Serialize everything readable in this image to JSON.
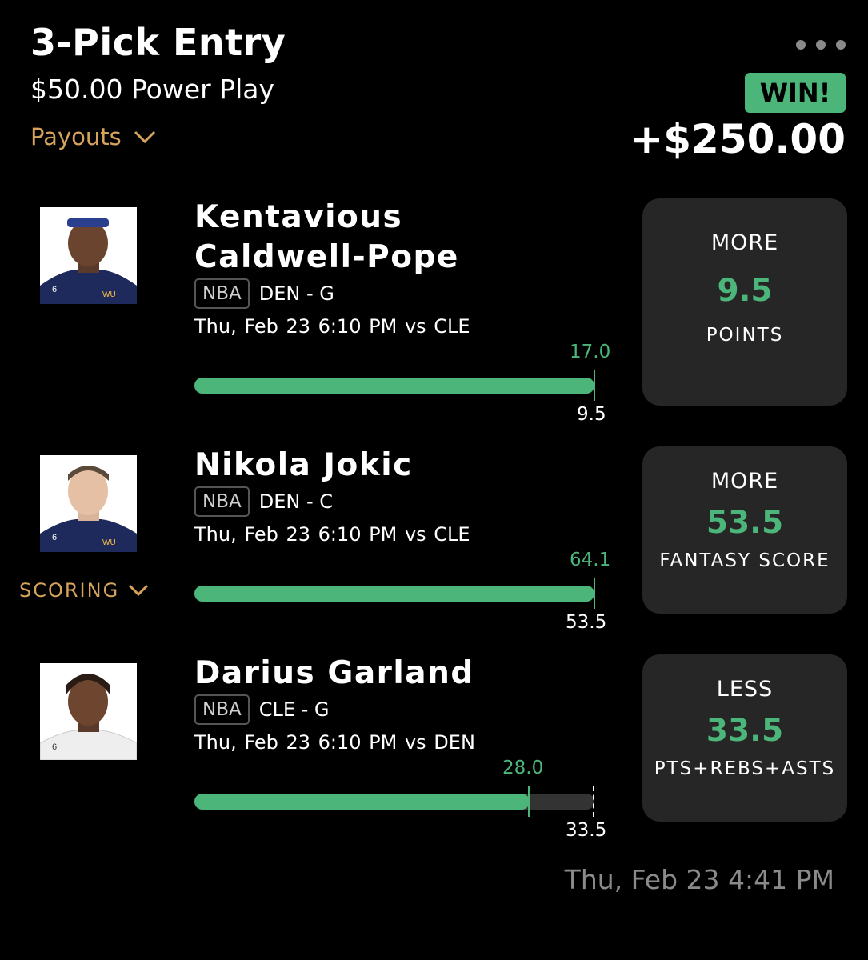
{
  "header": {
    "title": "3-Pick Entry",
    "subtitle": "$50.00 Power Play",
    "payouts_label": "Payouts",
    "status_badge": "WIN!",
    "payout_amount": "+$250.00"
  },
  "scoring_label": "SCORING",
  "picks": [
    {
      "player_name": "Kentavious Caldwell-Pope",
      "league": "NBA",
      "team_position": "DEN - G",
      "game_time": "Thu, Feb 23 6:10 PM  vs CLE",
      "actual": "17.0",
      "line": "9.5",
      "choice": "MORE",
      "stat": "POINTS",
      "progress_fraction": 1.0
    },
    {
      "player_name": "Nikola Jokic",
      "league": "NBA",
      "team_position": "DEN - C",
      "game_time": "Thu, Feb 23 6:10 PM  vs CLE",
      "actual": "64.1",
      "line": "53.5",
      "choice": "MORE",
      "stat": "FANTASY SCORE",
      "progress_fraction": 1.0
    },
    {
      "player_name": "Darius Garland",
      "league": "NBA",
      "team_position": "CLE - G",
      "game_time": "Thu, Feb 23 6:10 PM  vs DEN",
      "actual": "28.0",
      "line": "33.5",
      "choice": "LESS",
      "stat": "PTS+REBS+ASTS",
      "progress_fraction": 0.837
    }
  ],
  "entry_timestamp": "Thu, Feb 23 4:41 PM",
  "colors": {
    "accent_green": "#4cb57a",
    "gold": "#d6a35c",
    "card_bg": "#262626"
  }
}
